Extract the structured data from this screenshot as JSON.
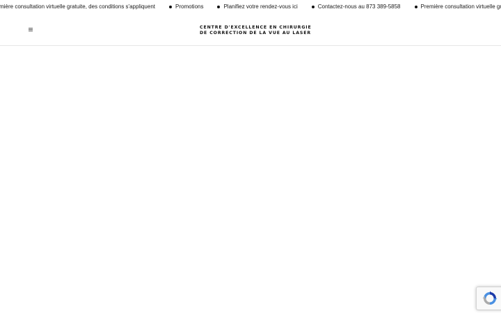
{
  "announcement_bar": {
    "items": [
      {
        "text": "remière consultation virtuelle gratuite, des conditions s'appliquent"
      },
      {
        "text": "Promotions"
      },
      {
        "text": "Planifiez votre rendez-vous ici"
      },
      {
        "text": "Contactez-nous au 873 389-5858"
      },
      {
        "text": "Première consultation virtuelle gratuite, des conditions s'appliquent"
      }
    ]
  },
  "header": {
    "menu_icon": "hamburger-menu-icon",
    "brand_line_1": "CENTRE D'EXCELLENCE EN CHIRURGIE",
    "brand_line_2": "DE CORRECTION DE LA VUE AU LASER"
  },
  "recaptcha": {
    "icon": "recaptcha-icon"
  }
}
